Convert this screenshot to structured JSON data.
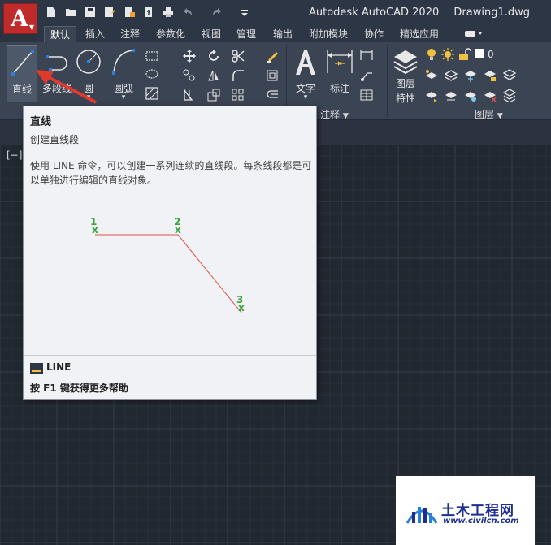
{
  "titlebar": {
    "app_letter": "A",
    "app_name": "Autodesk AutoCAD 2020",
    "document": "Drawing1.dwg",
    "quick_access_icons": [
      "new-icon",
      "open-icon",
      "save-icon",
      "save-as-icon",
      "web-save-icon",
      "publish-icon",
      "print-icon",
      "undo-icon",
      "redo-icon",
      "customize-icon"
    ]
  },
  "tabs": [
    {
      "label": "默认",
      "active": true
    },
    {
      "label": "插入"
    },
    {
      "label": "注释"
    },
    {
      "label": "参数化"
    },
    {
      "label": "视图"
    },
    {
      "label": "管理"
    },
    {
      "label": "输出"
    },
    {
      "label": "附加模块"
    },
    {
      "label": "协作"
    },
    {
      "label": "精选应用"
    }
  ],
  "ribbon": {
    "draw_tools": [
      {
        "label": "直线",
        "icon": "line-icon"
      },
      {
        "label": "多段线",
        "icon": "polyline-icon"
      },
      {
        "label": "圆",
        "icon": "circle-icon"
      },
      {
        "label": "圆弧",
        "icon": "arc-icon"
      }
    ],
    "annotation_tools": [
      {
        "label": "文字",
        "icon": "text-icon"
      },
      {
        "label": "标注",
        "icon": "dimension-icon"
      }
    ],
    "annotation_panel_label": "注释",
    "layer_tool": {
      "label_line1": "图层",
      "label_line2": "特性",
      "icon": "layer-properties-icon"
    },
    "layer_panel_label": "图层",
    "current_layer": "0"
  },
  "tooltip": {
    "title": "直线",
    "subtitle": "创建直线段",
    "description": "使用 LINE 命令，可以创建一系列连续的直线段。每条线段都是可以单独进行编辑的直线对象。",
    "points": [
      "1",
      "2",
      "3"
    ],
    "command": "LINE",
    "help": "按 F1 键获得更多帮助"
  },
  "canvas": {
    "viewport_label": "[−]"
  },
  "watermark": {
    "title": "土木工程网",
    "url": "www.civilcn.com"
  },
  "colors": {
    "accent_red": "#c02a2a",
    "diagram_green": "#3aa23a",
    "diagram_line": "#e05050",
    "arrow": "#e03a2f"
  }
}
